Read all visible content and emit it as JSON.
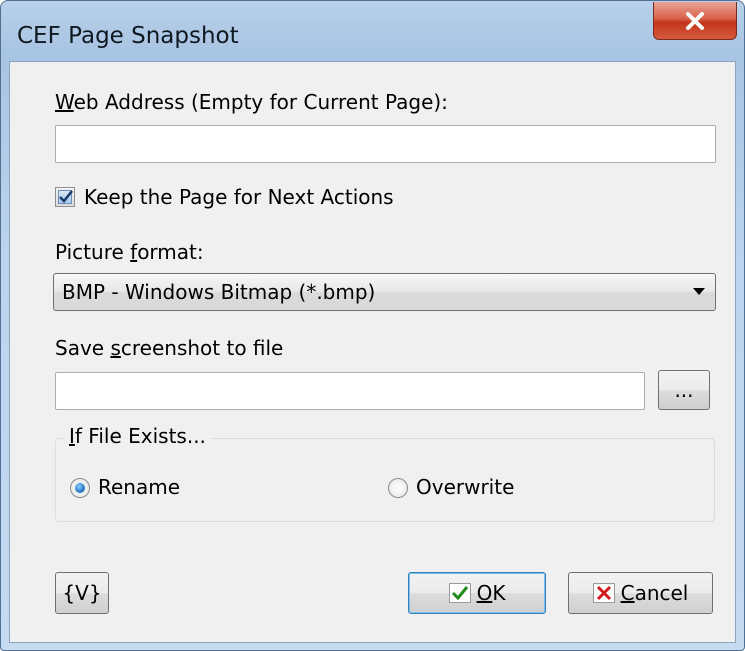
{
  "window": {
    "title": "CEF Page Snapshot",
    "close_icon": "close-icon",
    "accent_color": "#c4341d"
  },
  "form": {
    "web_address": {
      "label_mnemonic": "W",
      "label_rest": "eb Address (Empty for Current Page):",
      "value": ""
    },
    "keep_page": {
      "label": "Keep the Page for Next Actions",
      "checked": true
    },
    "picture_format": {
      "label_before": "Picture ",
      "label_mnemonic": "f",
      "label_after": "ormat:",
      "selected": "BMP - Windows Bitmap (*.bmp)"
    },
    "save_file": {
      "label_before": "Save ",
      "label_mnemonic": "s",
      "label_after": "creenshot to file",
      "value": "",
      "browse_label": "..."
    },
    "if_exists": {
      "title_mnemonic": "I",
      "title_rest": "f File Exists...",
      "options": [
        {
          "label": "Rename",
          "selected": true
        },
        {
          "label": "Overwrite",
          "selected": false
        }
      ]
    }
  },
  "buttons": {
    "variables_label": "{V}",
    "ok_mnemonic": "O",
    "ok_rest": "K",
    "cancel_mnemonic": "C",
    "cancel_rest": "ancel"
  }
}
